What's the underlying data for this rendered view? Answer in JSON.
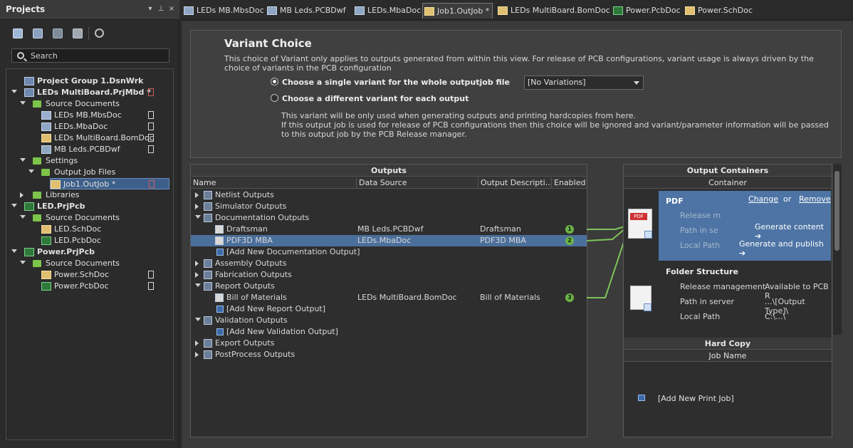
{
  "projects_panel": {
    "title": "Projects",
    "header_buttons": [
      "▾",
      "⊥",
      "×"
    ],
    "search_placeholder": "Search",
    "tree": [
      {
        "label": "Project Group 1.DsnWrk",
        "level": 0,
        "icon": "workspace-icon",
        "bold": true
      },
      {
        "label": "LEDs MultiBoard.PrjMbd *",
        "level": 0,
        "icon": "multiboard-project-icon",
        "bold": true,
        "expanded": true,
        "note": "red"
      },
      {
        "label": "Source Documents",
        "level": 1,
        "icon": "folder-icon",
        "expanded": true
      },
      {
        "label": "LEDs MB.MbsDoc",
        "level": 2,
        "icon": "mbs-document-icon",
        "note": "white"
      },
      {
        "label": "LEDs.MbaDoc",
        "level": 2,
        "icon": "mba-document-icon",
        "note": "white"
      },
      {
        "label": "LEDs MultiBoard.BomDoc",
        "level": 2,
        "icon": "bom-document-icon",
        "note": "white"
      },
      {
        "label": "MB Leds.PCBDwf",
        "level": 2,
        "icon": "draftsman-document-icon",
        "note": "white"
      },
      {
        "label": "Settings",
        "level": 1,
        "icon": "folder-icon",
        "expanded": true
      },
      {
        "label": "Output Job Files",
        "level": 2,
        "icon": "folder-icon",
        "expanded": true
      },
      {
        "label": "Job1.OutJob *",
        "level": 3,
        "icon": "outjob-document-icon",
        "selected": true,
        "note": "red"
      },
      {
        "label": "Libraries",
        "level": 1,
        "icon": "folder-icon",
        "expanded": false
      },
      {
        "label": "LED.PrjPcb",
        "level": 0,
        "icon": "pcb-project-icon",
        "bold": true,
        "expanded": true
      },
      {
        "label": "Source Documents",
        "level": 1,
        "icon": "folder-icon",
        "expanded": true
      },
      {
        "label": "LED.SchDoc",
        "level": 2,
        "icon": "schematic-document-icon"
      },
      {
        "label": "LED.PcbDoc",
        "level": 2,
        "icon": "pcb-document-icon"
      },
      {
        "label": "Power.PrjPcb",
        "level": 0,
        "icon": "pcb-project-icon",
        "bold": true,
        "expanded": true
      },
      {
        "label": "Source Documents",
        "level": 1,
        "icon": "folder-icon",
        "expanded": true
      },
      {
        "label": "Power.SchDoc",
        "level": 2,
        "icon": "schematic-document-icon",
        "note": "white"
      },
      {
        "label": "Power.PcbDoc",
        "level": 2,
        "icon": "pcb-document-icon",
        "note": "white"
      }
    ]
  },
  "tabs": [
    {
      "label": "LEDs MB.MbsDoc",
      "icon": "mbs-document-icon"
    },
    {
      "label": "MB Leds.PCBDwf",
      "icon": "draftsman-document-icon"
    },
    {
      "label": "LEDs.MbaDoc",
      "icon": "mba-document-icon"
    },
    {
      "label": "Job1.OutJob *",
      "icon": "outjob-document-icon",
      "active": true
    },
    {
      "label": "LEDs MultiBoard.BomDoc",
      "icon": "bom-document-icon"
    },
    {
      "label": "Power.PcbDoc",
      "icon": "pcb-document-icon"
    },
    {
      "label": "Power.SchDoc",
      "icon": "schematic-document-icon"
    }
  ],
  "variant": {
    "title": "Variant Choice",
    "description": "This choice of Variant only applies to outputs generated from within this view. For release of PCB configurations, variant usage is always driven by the choice of variants in the PCB configuration",
    "option_single": "Choose a single variant for the whole outputjob file",
    "option_each": "Choose a different variant for each output",
    "selected_variant": "[No Variations]",
    "note_line1": "This variant will be only used when generating outputs and printing hardcopies from here.",
    "note_line2": "If this output job is used for release of PCB configurations then this choice will be ignored and variant/parameter information will be passed to this output job by the PCB Release manager."
  },
  "outputs": {
    "title": "Outputs",
    "columns": [
      "Name",
      "Data Source",
      "Output Descripti...",
      "Enabled"
    ],
    "rows": [
      {
        "type": "group",
        "name": "Netlist Outputs",
        "expanded": false
      },
      {
        "type": "group",
        "name": "Simulator Outputs",
        "expanded": false
      },
      {
        "type": "group",
        "name": "Documentation Outputs",
        "expanded": true
      },
      {
        "type": "item",
        "name": "Draftsman",
        "source": "MB Leds.PCBDwf",
        "desc": "Draftsman",
        "enabled": "1"
      },
      {
        "type": "item",
        "name": "PDF3D MBA",
        "source": "LEDs.MbaDoc",
        "desc": "PDF3D MBA",
        "enabled": "2",
        "selected": true
      },
      {
        "type": "add",
        "name": "[Add New Documentation Output]"
      },
      {
        "type": "group",
        "name": "Assembly Outputs",
        "expanded": false
      },
      {
        "type": "group",
        "name": "Fabrication Outputs",
        "expanded": false
      },
      {
        "type": "group",
        "name": "Report Outputs",
        "expanded": true
      },
      {
        "type": "item",
        "name": "Bill of Materials",
        "source": "LEDs MultiBoard.BomDoc",
        "desc": "Bill of Materials",
        "enabled": "3"
      },
      {
        "type": "add",
        "name": "[Add New Report Output]"
      },
      {
        "type": "group",
        "name": "Validation Outputs",
        "expanded": true
      },
      {
        "type": "add",
        "name": "[Add New Validation Output]"
      },
      {
        "type": "group",
        "name": "Export Outputs",
        "expanded": false
      },
      {
        "type": "group",
        "name": "PostProcess Outputs",
        "expanded": false
      }
    ]
  },
  "containers": {
    "title": "Output Containers",
    "subheader": "Container",
    "pdf": {
      "name": "PDF",
      "change": "Change",
      "or": "or",
      "remove": "Remove",
      "release_label": "Release m",
      "path_server_label": "Path in se",
      "local_path_label": "Local Path",
      "generate_content": "Generate content ➔",
      "generate_publish": "Generate and publish ➔"
    },
    "folder": {
      "name": "Folder Structure",
      "release_label": "Release management",
      "release_value": "Available to PCB R",
      "path_server_label": "Path in server",
      "path_server_value": "...\\[Output Type]\\",
      "local_path_label": "Local Path",
      "local_path_value": "C:\\...\\"
    },
    "hardcopy_title": "Hard Copy",
    "hardcopy_subheader": "Job Name",
    "add_print_job": "[Add New Print Job]"
  },
  "colors": {
    "accent_selection": "#4b6f9b",
    "enabled_badge": "#6cb347",
    "connector_line": "#7dc35a",
    "pdf_block": "#4d74a4"
  }
}
